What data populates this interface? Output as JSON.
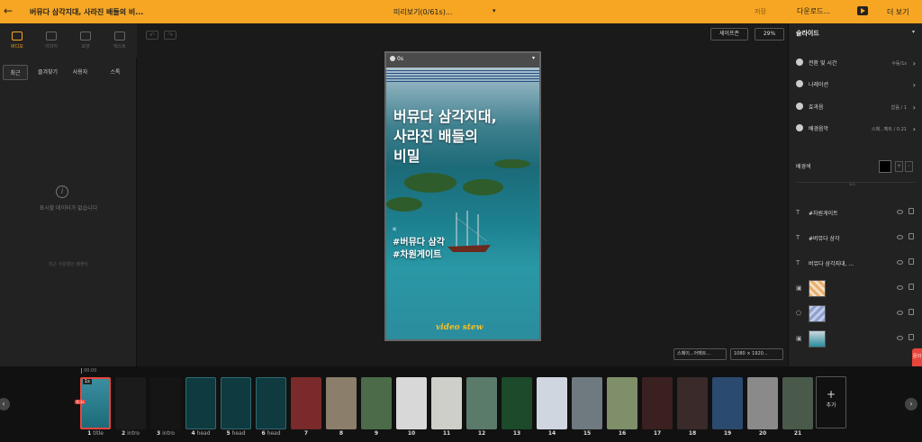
{
  "topbar": {
    "back_icon": "arrow-left-icon",
    "project_title": "버뮤다 삼각지대, 사라진 배들의 비...",
    "preview_label": "미리보기(0/61s)...",
    "save_label": "저장",
    "download_label": "다운로드...",
    "more_label": "더 보기"
  },
  "left_tabs": [
    "비디오",
    "이미지",
    "모양",
    "텍스트"
  ],
  "left_subtabs": [
    "최근",
    "즐겨찾기",
    "사용자",
    "스톡"
  ],
  "left_panel": {
    "empty_text": "표시할 데이터가 없습니다",
    "hint_text": "최근 사용했던 템플릿"
  },
  "canvas": {
    "safe_zone_label": "세이프존",
    "zoom_label": "29%",
    "music_chip": "스페이...어펙트...",
    "size_chip": "1080 × 1920...",
    "duration": "0s",
    "headline": "버뮤다 삼각지대,\n사라진 배들의\n비밀",
    "small_tag": "예",
    "hashtag1": "#버뮤다 삼각",
    "hashtag2": "#차원게이트",
    "logo": "video stew"
  },
  "right_panel": {
    "title": "슬라이드",
    "rows": [
      {
        "label": "전환 및 시간",
        "value": "수동/1s"
      },
      {
        "label": "나레이션",
        "value": ""
      },
      {
        "label": "효과음",
        "value": "없음 / 1"
      },
      {
        "label": "배경음악",
        "value": "스페...펙트 / 0.21"
      }
    ],
    "bg_color_label": "배경색",
    "bg_color": "#000000",
    "layer_sep_label": "요소",
    "layers": [
      {
        "type": "T",
        "name": "#차원게이트"
      },
      {
        "type": "T",
        "name": "#버뮤다 삼각"
      },
      {
        "type": "T",
        "name": "버뮤다 삼각지대, ..."
      },
      {
        "type": "img",
        "name": ""
      },
      {
        "type": "shape",
        "name": ""
      },
      {
        "type": "img",
        "name": ""
      }
    ]
  },
  "chat_label": "문의",
  "timeline": {
    "time": "00:00",
    "add_label": "추가",
    "slides": [
      {
        "num": "1",
        "name": "title"
      },
      {
        "num": "2",
        "name": "intro"
      },
      {
        "num": "3",
        "name": "intro"
      },
      {
        "num": "4",
        "name": "head"
      },
      {
        "num": "5",
        "name": "head"
      },
      {
        "num": "6",
        "name": "head"
      },
      {
        "num": "7",
        "name": ""
      },
      {
        "num": "8",
        "name": ""
      },
      {
        "num": "9",
        "name": ""
      },
      {
        "num": "10",
        "name": ""
      },
      {
        "num": "11",
        "name": ""
      },
      {
        "num": "12",
        "name": ""
      },
      {
        "num": "13",
        "name": ""
      },
      {
        "num": "14",
        "name": ""
      },
      {
        "num": "15",
        "name": ""
      },
      {
        "num": "16",
        "name": ""
      },
      {
        "num": "17",
        "name": ""
      },
      {
        "num": "18",
        "name": ""
      },
      {
        "num": "19",
        "name": ""
      },
      {
        "num": "20",
        "name": ""
      },
      {
        "num": "21",
        "name": ""
      }
    ],
    "first_slide_badge": "1s",
    "first_slide_sub": "0.3s"
  },
  "colors": {
    "accent": "#f6a623",
    "panel": "#222222",
    "canvas": "#1a1a1a"
  }
}
